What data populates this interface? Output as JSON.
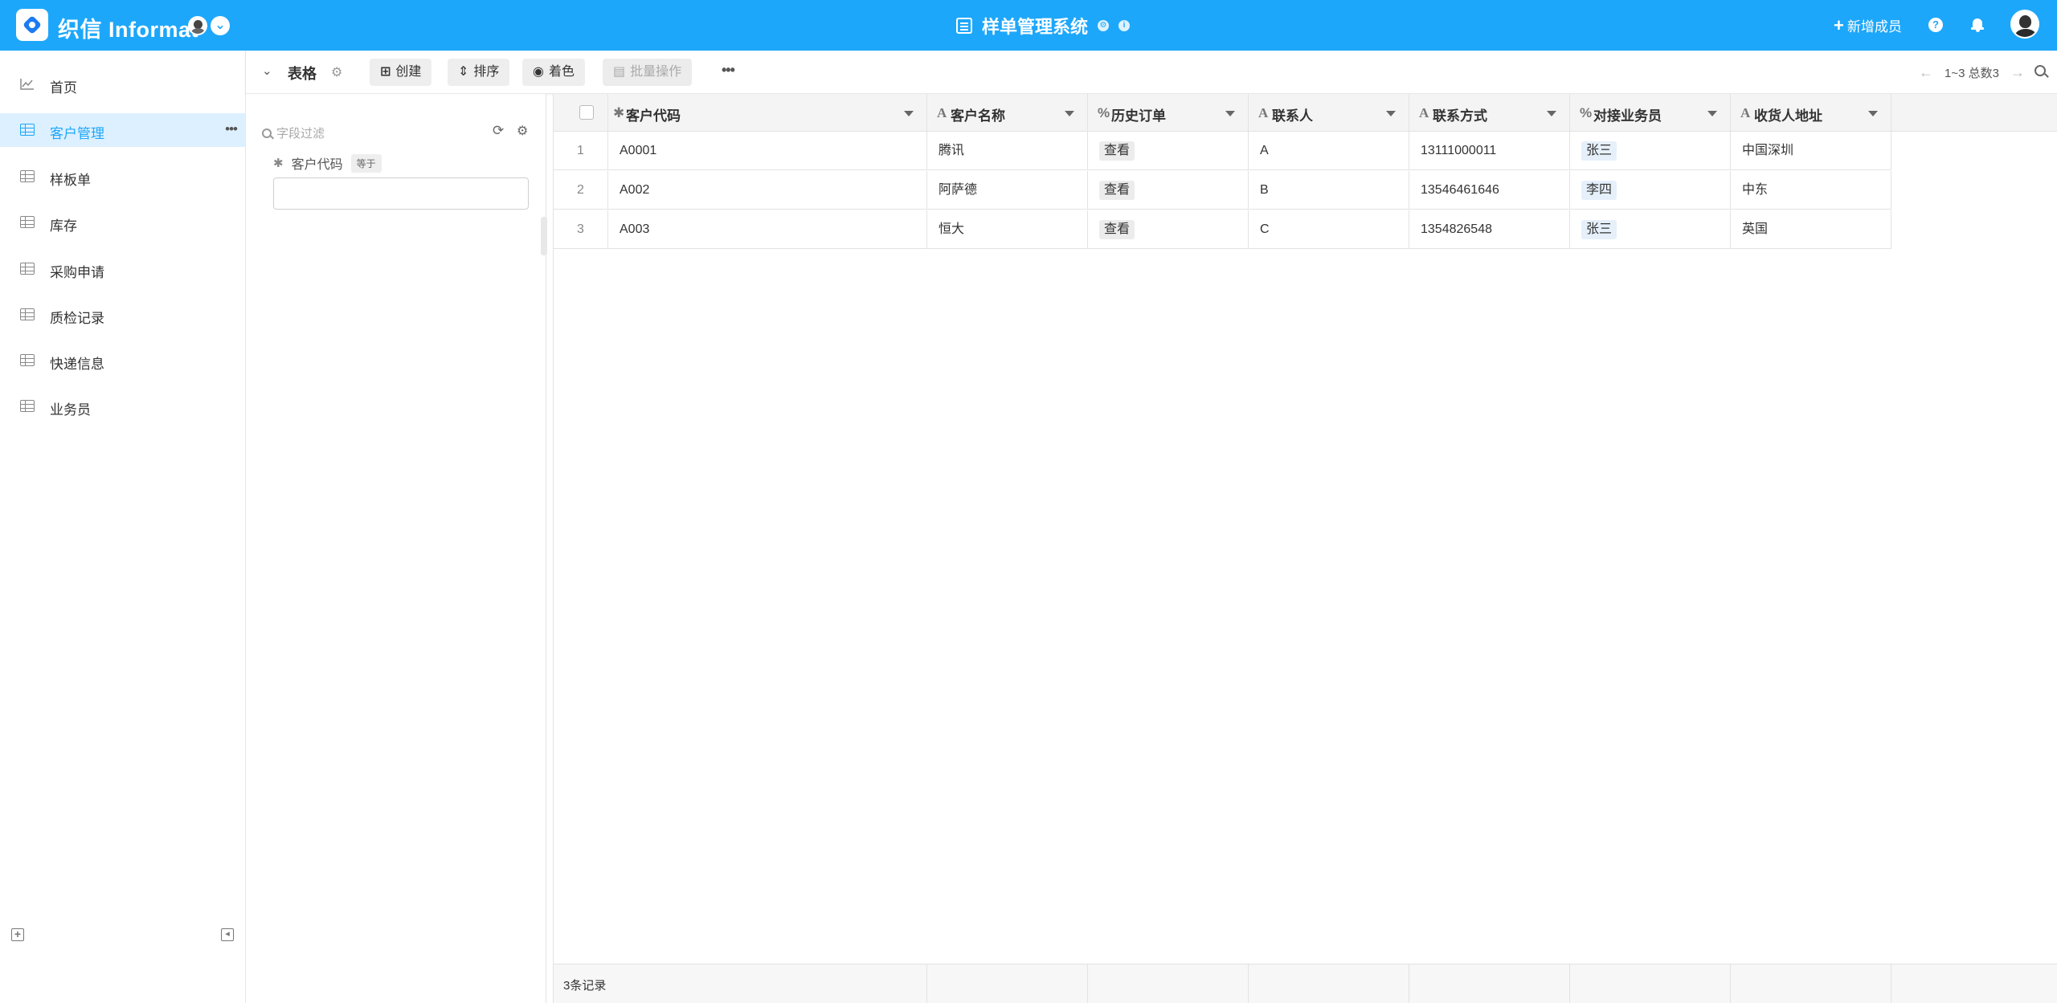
{
  "app": {
    "brand": "织信 Informat",
    "title": "样单管理系统",
    "new_member": "新增成员"
  },
  "sidebar": {
    "items": [
      {
        "label": "首页",
        "icon": "chart-line-icon"
      },
      {
        "label": "客户管理",
        "icon": "table-icon",
        "active": true
      },
      {
        "label": "样板单",
        "icon": "table-icon"
      },
      {
        "label": "库存",
        "icon": "table-icon"
      },
      {
        "label": "采购申请",
        "icon": "table-icon"
      },
      {
        "label": "质检记录",
        "icon": "table-icon"
      },
      {
        "label": "快递信息",
        "icon": "table-icon"
      },
      {
        "label": "业务员",
        "icon": "table-icon"
      }
    ],
    "more": "•••"
  },
  "toolbar": {
    "view_title": "表格",
    "create": "创建",
    "sort": "排序",
    "color": "着色",
    "batch": "批量操作",
    "more": "•••",
    "pager": "1~3 总数3"
  },
  "filter": {
    "placeholder": "字段过滤",
    "field_label": "客户代码",
    "operator": "等于",
    "value": ""
  },
  "table": {
    "columns": [
      {
        "label": "客户代码",
        "icon": "asterisk-icon"
      },
      {
        "label": "客户名称",
        "icon": "text-icon"
      },
      {
        "label": "历史订单",
        "icon": "link-icon"
      },
      {
        "label": "联系人",
        "icon": "text-icon"
      },
      {
        "label": "联系方式",
        "icon": "text-icon"
      },
      {
        "label": "对接业务员",
        "icon": "link-icon"
      },
      {
        "label": "收货人地址",
        "icon": "text-icon"
      }
    ],
    "rows": [
      {
        "idx": "1",
        "code": "A0001",
        "name": "腾讯",
        "orders": "查看",
        "contact": "A",
        "phone": "13111000011",
        "sales": "张三",
        "address": "中国深圳"
      },
      {
        "idx": "2",
        "code": "A002",
        "name": "阿萨德",
        "orders": "查看",
        "contact": "B",
        "phone": "13546461646",
        "sales": "李四",
        "address": "中东"
      },
      {
        "idx": "3",
        "code": "A003",
        "name": "恒大",
        "orders": "查看",
        "contact": "C",
        "phone": "1354826548",
        "sales": "张三",
        "address": "英国"
      }
    ],
    "footer": "3条记录"
  },
  "colors": {
    "topbar": "#1da7fa",
    "active_bg": "#ddf0ff",
    "active_text": "#1da7fa"
  }
}
